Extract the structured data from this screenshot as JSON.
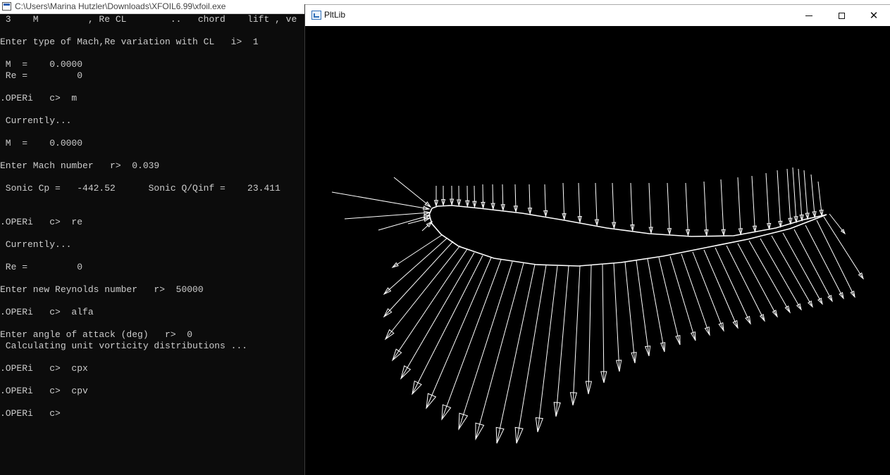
{
  "console": {
    "title": "C:\\Users\\Marina Hutzler\\Downloads\\XFOIL6.99\\xfoil.exe",
    "lines": [
      " 3    M         , Re CL        ..   chord    lift , ve",
      "",
      "Enter type of Mach,Re variation with CL   i>  1",
      "",
      " M  =    0.0000",
      " Re =         0",
      "",
      ".OPERi   c>  m",
      "",
      " Currently...",
      "",
      " M  =    0.0000",
      "",
      "Enter Mach number   r>  0.039",
      "",
      " Sonic Cp =   -442.52      Sonic Q/Qinf =    23.411",
      "",
      "",
      ".OPERi   c>  re",
      "",
      " Currently...",
      "",
      " Re =         0",
      "",
      "Enter new Reynolds number   r>  50000",
      "",
      ".OPERi   c>  alfa",
      "",
      "Enter angle of attack (deg)   r>  0",
      " Calculating unit vorticity distributions ...",
      "",
      ".OPERi   c>  cpx",
      "",
      ".OPERi   c>  cpv",
      "",
      ".OPERi   c>"
    ]
  },
  "plot_window": {
    "title": "PltLib",
    "icons": {
      "app": "pltlib-app-icon",
      "minimize": "minimize-icon",
      "maximize": "maximize-icon",
      "close": "close-icon"
    },
    "close_glyph": "✕",
    "colors": {
      "background": "#000000",
      "stroke": "#ffffff"
    }
  }
}
